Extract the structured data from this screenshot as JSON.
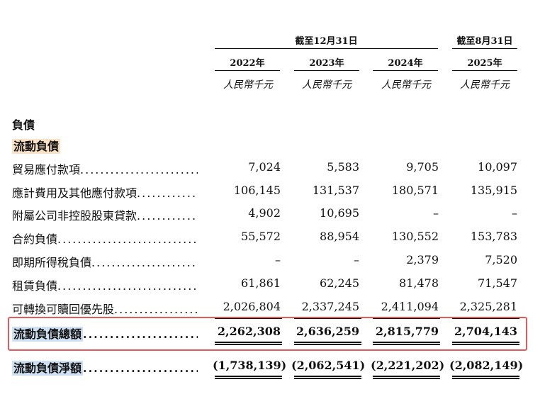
{
  "header": {
    "period_group1": "截至12月31日",
    "period_group2": "截至8月31日",
    "years": [
      "2022年",
      "2023年",
      "2024年",
      "2025年"
    ],
    "unit": "人民幣千元"
  },
  "sections": {
    "liabilities": "負債",
    "current_liabilities": "流動負債"
  },
  "rows": [
    {
      "label": "貿易應付款項",
      "values": [
        "7,024",
        "5,583",
        "9,705",
        "10,097"
      ]
    },
    {
      "label": "應計費用及其他應付款項",
      "values": [
        "106,145",
        "131,537",
        "180,571",
        "135,915"
      ]
    },
    {
      "label": "附屬公司非控股股東貸款",
      "values": [
        "4,902",
        "10,695",
        "–",
        "–"
      ]
    },
    {
      "label": "合約負債",
      "values": [
        "55,572",
        "88,954",
        "130,552",
        "153,783"
      ]
    },
    {
      "label": "即期所得稅負債",
      "values": [
        "–",
        "–",
        "2,379",
        "7,520"
      ]
    },
    {
      "label": "租賃負債",
      "values": [
        "61,861",
        "62,245",
        "81,478",
        "71,547"
      ]
    },
    {
      "label": "可轉換可贖回優先股",
      "values": [
        "2,026,804",
        "2,337,245",
        "2,411,094",
        "2,325,281"
      ]
    }
  ],
  "total": {
    "label": "流動負債總額",
    "values": [
      "2,262,308",
      "2,636,259",
      "2,815,779",
      "2,704,143"
    ]
  },
  "net": {
    "label": "流動負債淨額",
    "values": [
      "(1,738,139)",
      "(2,062,541)",
      "(2,221,202)",
      "(2,082,149)"
    ]
  },
  "leader_dots": "...................................................",
  "colors": {
    "highlight_orange": "#fbe2c6",
    "highlight_blue": "#cfe0f3",
    "red_box": "#e35a5a"
  }
}
